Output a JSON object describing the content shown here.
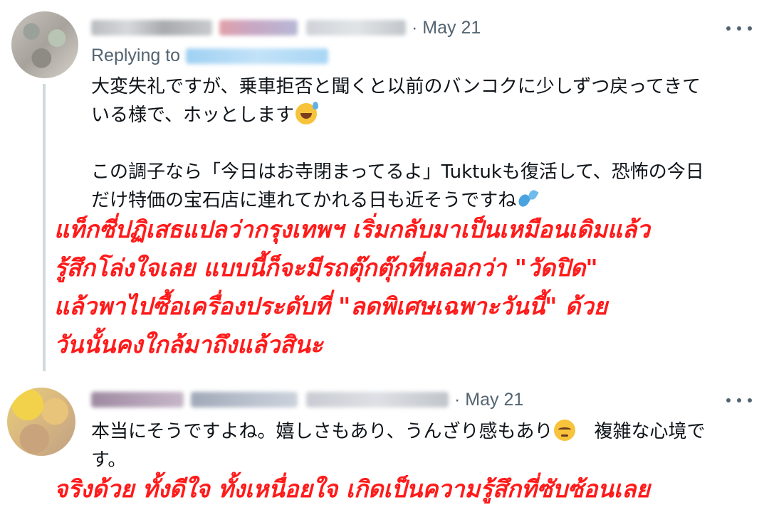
{
  "tweet1": {
    "date": "· May 21",
    "replying_label": "Replying to",
    "body_lines": [
      "大変失礼ですが、乗車拒否と聞くと以前のバンコクに少しずつ戻ってきて",
      "いる様で、ホッとします",
      "この調子なら「今日はお寺閉まってるよ」Tuktukも復活して、恐怖の今日",
      "だけ特価の宝石店に連れてかれる日も近そうですね"
    ],
    "emoji_1": "sweat-smile-emoji",
    "emoji_2": "droplets-emoji",
    "translation_lines": [
      "แท็กซี่ปฏิเสธแปลว่ากรุงเทพฯ เริ่มกลับมาเป็นเหมือนเดิมแล้ว",
      "รู้สึกโล่งใจเลย แบบนี้ก็จะมีรถตุ๊กตุ๊กที่หลอกว่า \"วัดปิด\"",
      "แล้วพาไปซื้อเครื่องประดับที่ \"ลดพิเศษเฉพาะวันนี้\" ด้วย",
      "วันนั้นคงใกล้มาถึงแล้วสินะ"
    ]
  },
  "tweet2": {
    "date": "· May 21",
    "body_lines": [
      "本当にそうですよね。嬉しさもあり、うんざり感もあり",
      "　複雑な心境で",
      "す。"
    ],
    "emoji": "pensive-emoji",
    "translation_lines": [
      "จริงด้วย ทั้งดีใจ ทั้งเหนื่อยใจ เกิดเป็นความรู้สึกที่ซับซ้อนเลย"
    ]
  },
  "colors": {
    "translation": "#ff1a1a",
    "secondary_text": "#536471",
    "primary_text": "#0f1419",
    "thread_line": "#cfd9de"
  },
  "icons": {
    "more": "more-horizontal-icon"
  }
}
